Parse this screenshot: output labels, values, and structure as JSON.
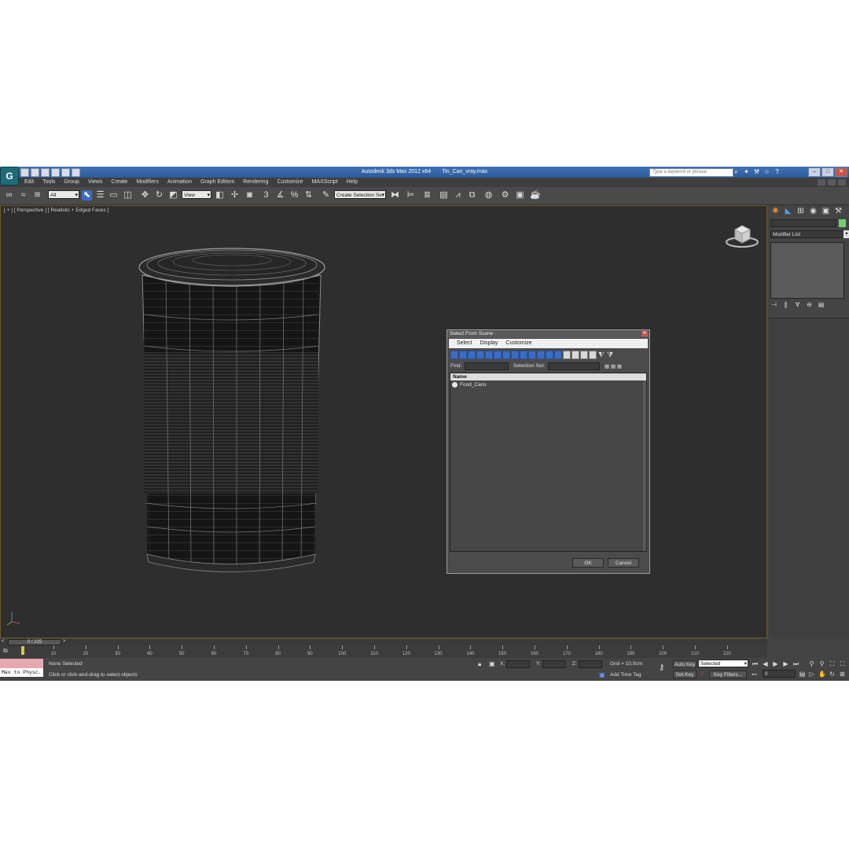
{
  "titlebar": {
    "app_title": "Autodesk 3ds Max  2012 x64",
    "file_name": "Tin_Can_vray.max",
    "search_placeholder": "Type a keyword or phrase",
    "logo": "3ds-max-logo-icon"
  },
  "menubar": {
    "items": [
      "Edit",
      "Tools",
      "Group",
      "Views",
      "Create",
      "Modifiers",
      "Animation",
      "Graph Editors",
      "Rendering",
      "Customize",
      "MAXScript",
      "Help"
    ]
  },
  "toolbar": {
    "filter_value": "All",
    "coord_value": "View",
    "selection_set_value": "Create Selection Se"
  },
  "viewport": {
    "label": "[ + ] [ Perspective ] [ Realistic + Edged Faces ]"
  },
  "dialog": {
    "title": "Select From Scene",
    "close": "✕",
    "menu": [
      "Select",
      "Display",
      "Customize"
    ],
    "find_label": "Find:",
    "selection_set_label": "Selection Set:",
    "column_name": "Name",
    "items": [
      "Food_Cans"
    ],
    "ok_label": "OK",
    "cancel_label": "Cancel"
  },
  "command_panel": {
    "modifier_list_label": "Modifier List",
    "object_color": "#6fd36f"
  },
  "time_slider": {
    "position_label": "0 / 225",
    "prev": "<",
    "next": ">"
  },
  "track": {
    "labels": [
      "10",
      "20",
      "30",
      "40",
      "50",
      "60",
      "70",
      "80",
      "90",
      "100",
      "110",
      "120",
      "130",
      "140",
      "150",
      "160",
      "170",
      "180",
      "190",
      "200",
      "210",
      "220"
    ]
  },
  "status": {
    "maxscript_text": "Max to Physc.",
    "selection_status": "None Selected",
    "prompt": "Click or click-and-drag to select objects",
    "x_label": "X:",
    "y_label": "Y:",
    "z_label": "Z:",
    "grid": "Grid = 10,0cm",
    "add_time_tag": "Add Time Tag",
    "auto_key": "Auto Key",
    "set_key": "Set Key",
    "selected_value": "Selected",
    "key_filters": "Key Filters...",
    "frame_value": "0"
  },
  "colors": {
    "accent": "#3a6cc6",
    "viewport_bg": "#2e2e2e",
    "ui_bg": "#444444"
  }
}
